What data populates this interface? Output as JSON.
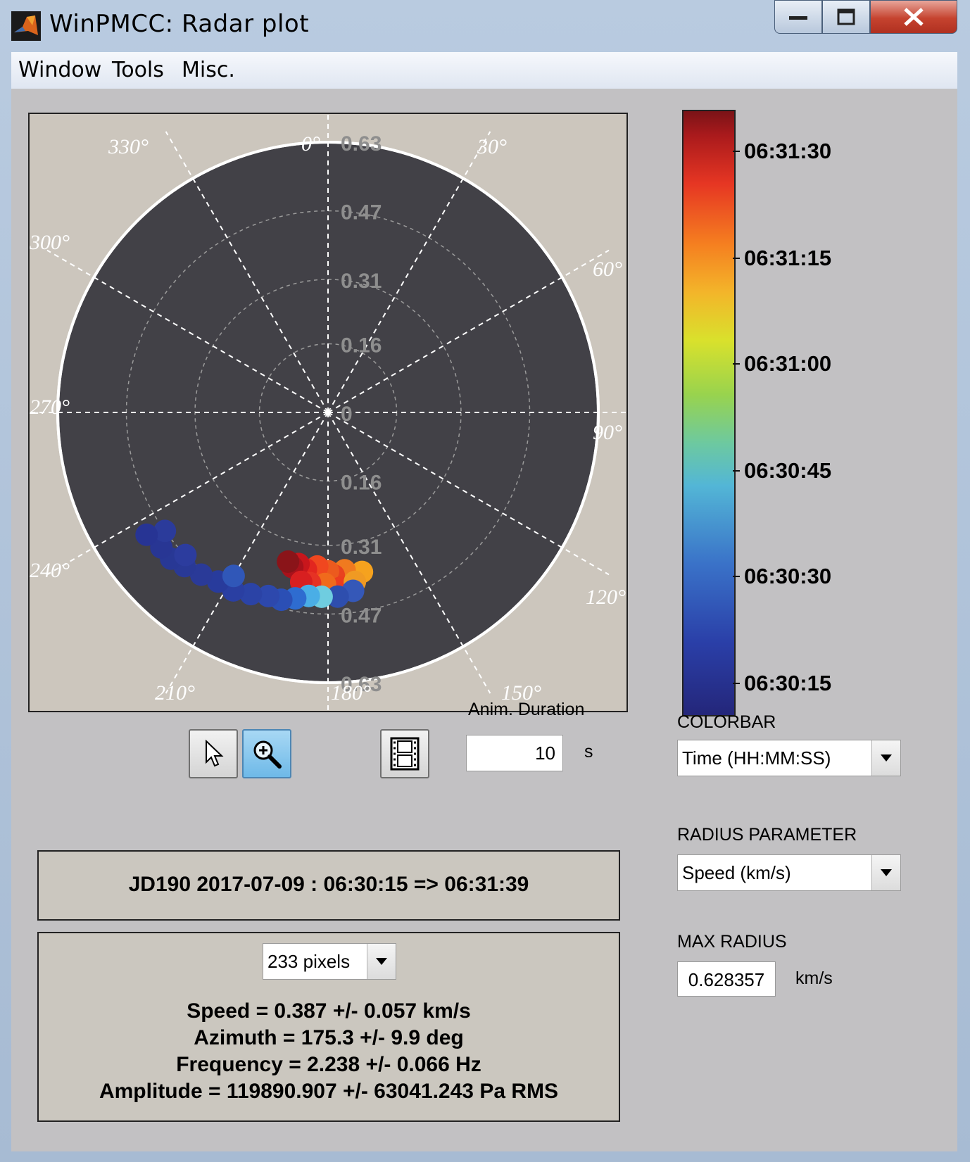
{
  "window": {
    "title": "WinPMCC: Radar plot"
  },
  "menu": [
    "Window",
    "Tools",
    "Misc."
  ],
  "polar": {
    "angle_labels": [
      "0°",
      "30°",
      "60°",
      "90°",
      "120°",
      "150°",
      "180°",
      "210°",
      "240°",
      "270°",
      "300°",
      "330°"
    ],
    "radius_labels_up": [
      "0.63",
      "0.47",
      "0.31",
      "0.16",
      "0"
    ],
    "radius_labels_down": [
      "0.16",
      "0.31",
      "0.47",
      "0.63"
    ]
  },
  "chart_data": {
    "type": "scatter",
    "coordinate_system": "polar",
    "theta_direction": "clockwise",
    "theta_zero": "top",
    "r_max": 0.63,
    "r_ticks": [
      0,
      0.16,
      0.31,
      0.47,
      0.63
    ],
    "theta_ticks_deg": [
      0,
      30,
      60,
      90,
      120,
      150,
      180,
      210,
      240,
      270,
      300,
      330
    ],
    "colorbar": {
      "label_ticks": [
        "06:31:30",
        "06:31:15",
        "06:31:00",
        "06:30:45",
        "06:30:30",
        "06:30:15"
      ],
      "colormap": "jet"
    },
    "points": [
      {
        "az": 168,
        "r": 0.38,
        "color": "#f6a21e"
      },
      {
        "az": 174,
        "r": 0.37,
        "color": "#f07a1f"
      },
      {
        "az": 178,
        "r": 0.38,
        "color": "#e8421f"
      },
      {
        "az": 180,
        "r": 0.37,
        "color": "#ec5a1e"
      },
      {
        "az": 184,
        "r": 0.36,
        "color": "#f0471f"
      },
      {
        "az": 188,
        "r": 0.37,
        "color": "#e2261f"
      },
      {
        "az": 191,
        "r": 0.36,
        "color": "#c8161c"
      },
      {
        "az": 193,
        "r": 0.37,
        "color": "#a8121b"
      },
      {
        "az": 195,
        "r": 0.36,
        "color": "#8a1419"
      },
      {
        "az": 176,
        "r": 0.41,
        "color": "#ec3c1f"
      },
      {
        "az": 181,
        "r": 0.4,
        "color": "#f06a1c"
      },
      {
        "az": 186,
        "r": 0.4,
        "color": "#e63224"
      },
      {
        "az": 189,
        "r": 0.4,
        "color": "#d81f20"
      },
      {
        "az": 171,
        "r": 0.4,
        "color": "#f09a23"
      },
      {
        "az": 172,
        "r": 0.42,
        "color": "#3558b8"
      },
      {
        "az": 177,
        "r": 0.43,
        "color": "#2e4eae"
      },
      {
        "az": 182,
        "r": 0.43,
        "color": "#6fcde0"
      },
      {
        "az": 186,
        "r": 0.43,
        "color": "#4aaee6"
      },
      {
        "az": 190,
        "r": 0.44,
        "color": "#2e6cd0"
      },
      {
        "az": 194,
        "r": 0.45,
        "color": "#2b4fb5"
      },
      {
        "az": 198,
        "r": 0.45,
        "color": "#2d48ad"
      },
      {
        "az": 203,
        "r": 0.46,
        "color": "#2b43a6"
      },
      {
        "az": 208,
        "r": 0.47,
        "color": "#2a3fa2"
      },
      {
        "az": 213,
        "r": 0.47,
        "color": "#283b9c"
      },
      {
        "az": 218,
        "r": 0.48,
        "color": "#2a3a98"
      },
      {
        "az": 223,
        "r": 0.49,
        "color": "#293996"
      },
      {
        "az": 227,
        "r": 0.5,
        "color": "#283895"
      },
      {
        "az": 231,
        "r": 0.5,
        "color": "#283694"
      },
      {
        "az": 234,
        "r": 0.47,
        "color": "#2b3b9b"
      },
      {
        "az": 236,
        "r": 0.51,
        "color": "#273494"
      },
      {
        "az": 225,
        "r": 0.47,
        "color": "#2c3c9e"
      },
      {
        "az": 210,
        "r": 0.44,
        "color": "#3057b8"
      }
    ]
  },
  "controls": {
    "anim_duration_label": "Anim. Duration",
    "anim_duration_value": "10",
    "anim_duration_unit": "s",
    "colorbar_label": "COLORBAR",
    "colorbar_selected": "Time (HH:MM:SS)",
    "radius_param_label": "RADIUS PARAMETER",
    "radius_param_selected": "Speed (km/s)",
    "max_radius_label": "MAX RADIUS",
    "max_radius_value": "0.628357",
    "max_radius_unit": "km/s"
  },
  "info": {
    "time_range": "JD190 2017-07-09 : 06:30:15 => 06:31:39",
    "pixels_selected": "233 pixels",
    "speed": "Speed = 0.387 +/- 0.057 km/s",
    "azimuth": "Azimuth = 175.3 +/- 9.9 deg",
    "frequency": "Frequency = 2.238 +/- 0.066 Hz",
    "amplitude": "Amplitude = 119890.907 +/- 63041.243 Pa RMS"
  }
}
